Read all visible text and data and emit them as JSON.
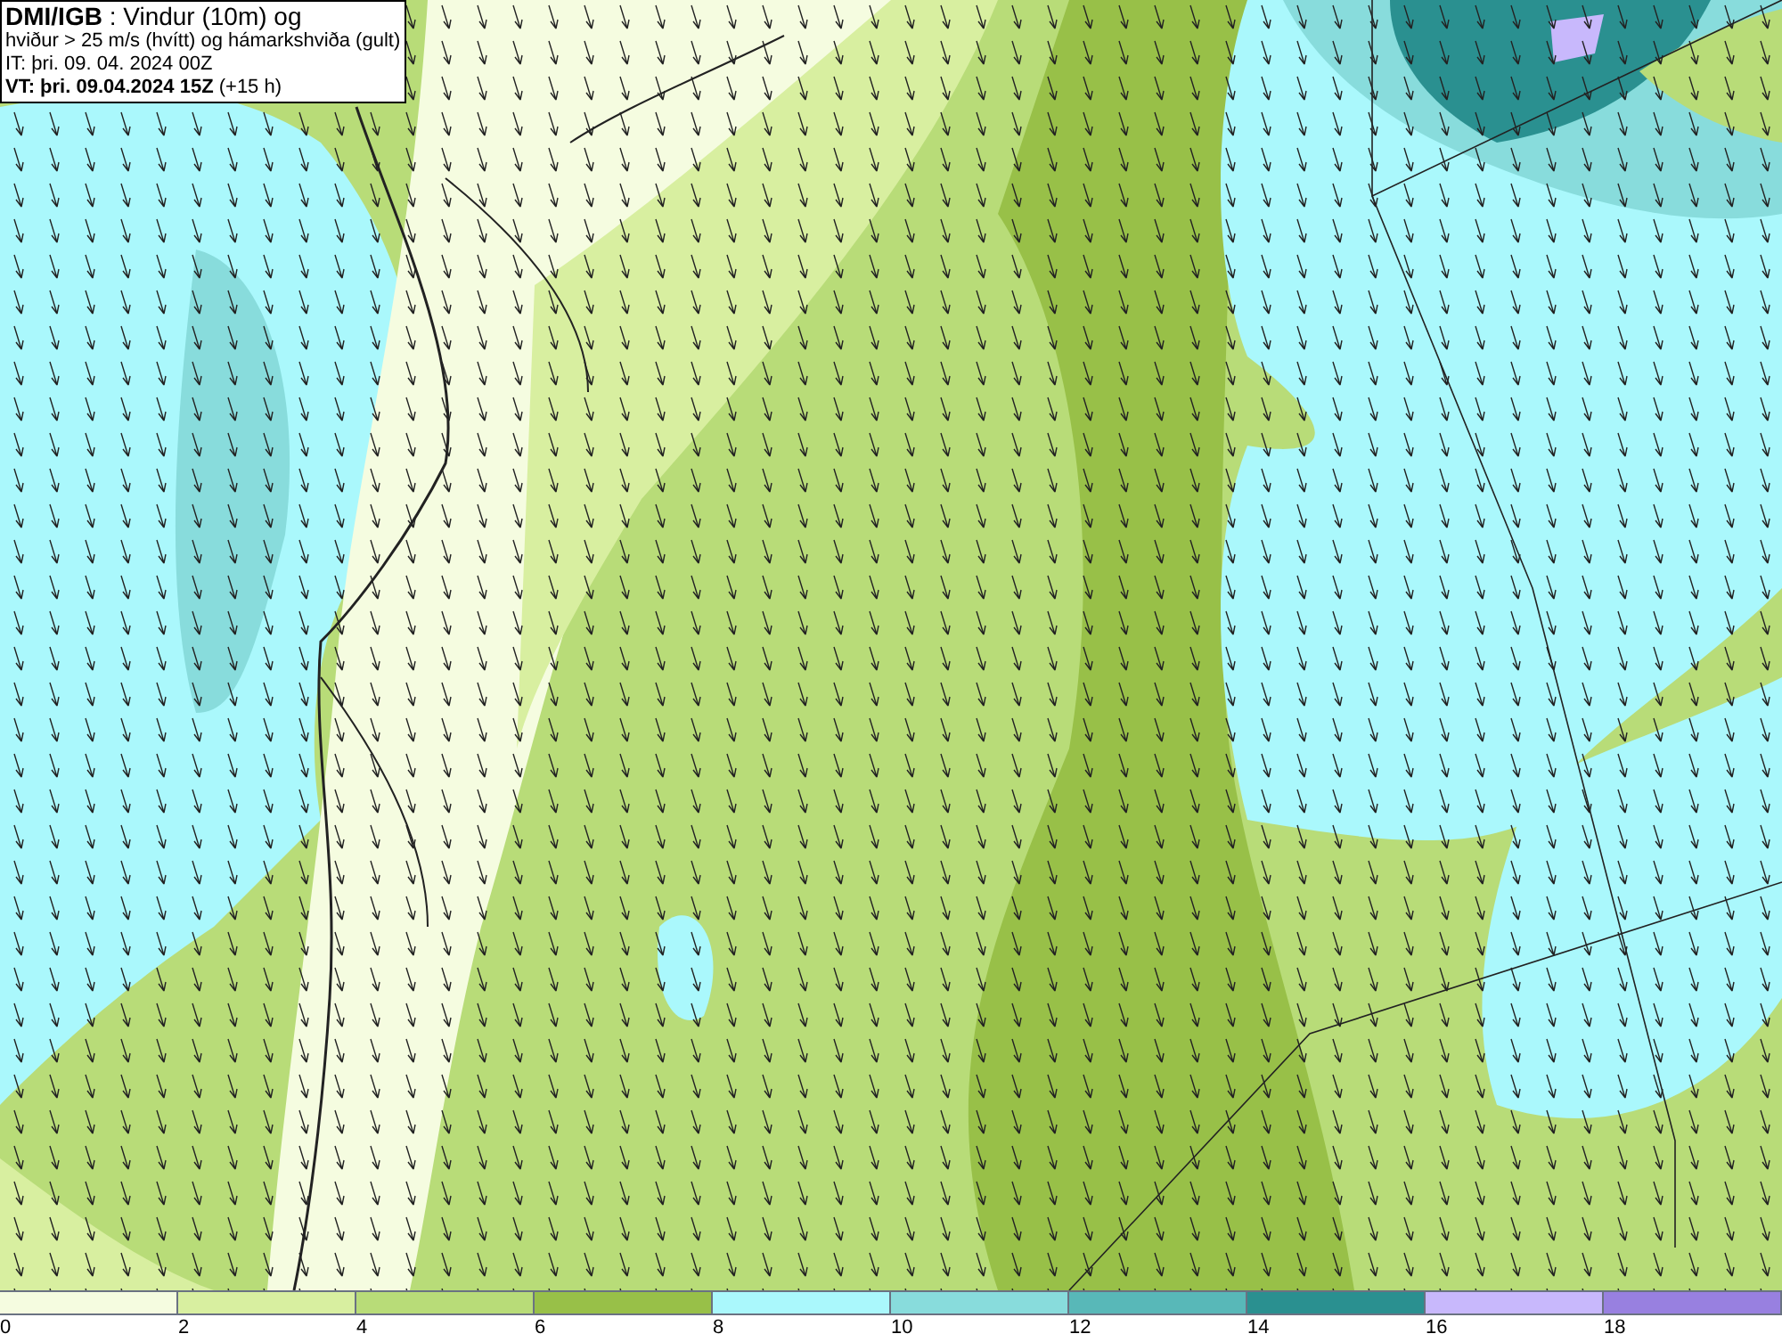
{
  "header": {
    "lines": [
      "**DMI/IGB** : Vindur (10m) og",
      "hviður > 25 m/s (hvítt) og hámarkshviða (gult)",
      "IT: þri. 09. 04. 2024 00Z",
      "**VT: þri. 09.04.2024 15Z** (+15 h)"
    ]
  },
  "legend": [
    {
      "label": "0",
      "color": "#f5fce0"
    },
    {
      "label": "2",
      "color": "#d8efa0"
    },
    {
      "label": "4",
      "color": "#b8dc78"
    },
    {
      "label": "6",
      "color": "#98c048"
    },
    {
      "label": "8",
      "color": "#aaf8fc"
    },
    {
      "label": "10",
      "color": "#88dcdc"
    },
    {
      "label": "12",
      "color": "#58b8b8"
    },
    {
      "label": "14",
      "color": "#2a9090"
    },
    {
      "label": "16",
      "color": "#c8b8fc"
    },
    {
      "label": "18",
      "color": "#9880e0"
    }
  ]
}
